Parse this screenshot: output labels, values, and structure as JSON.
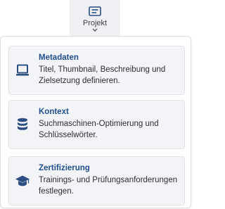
{
  "toolbar": {
    "project_button": {
      "label": "Projekt",
      "icon": "form-icon"
    }
  },
  "menu": {
    "items": [
      {
        "title": "Metadaten",
        "description": "Titel, Thumbnail, Beschreibung und Zielsetzung definieren.",
        "icon": "laptop-icon"
      },
      {
        "title": "Kontext",
        "description": "Suchmaschinen-Optimierung und Schlüsselwörter.",
        "icon": "database-icon"
      },
      {
        "title": "Zertifizierung",
        "description": "Trainings- und Prüfungsanforderungen festlegen.",
        "icon": "graduation-cap-icon"
      }
    ]
  },
  "colors": {
    "accent": "#1f4f8b",
    "icon": "#2b4f80",
    "card_bg": "#f2f4f7"
  }
}
